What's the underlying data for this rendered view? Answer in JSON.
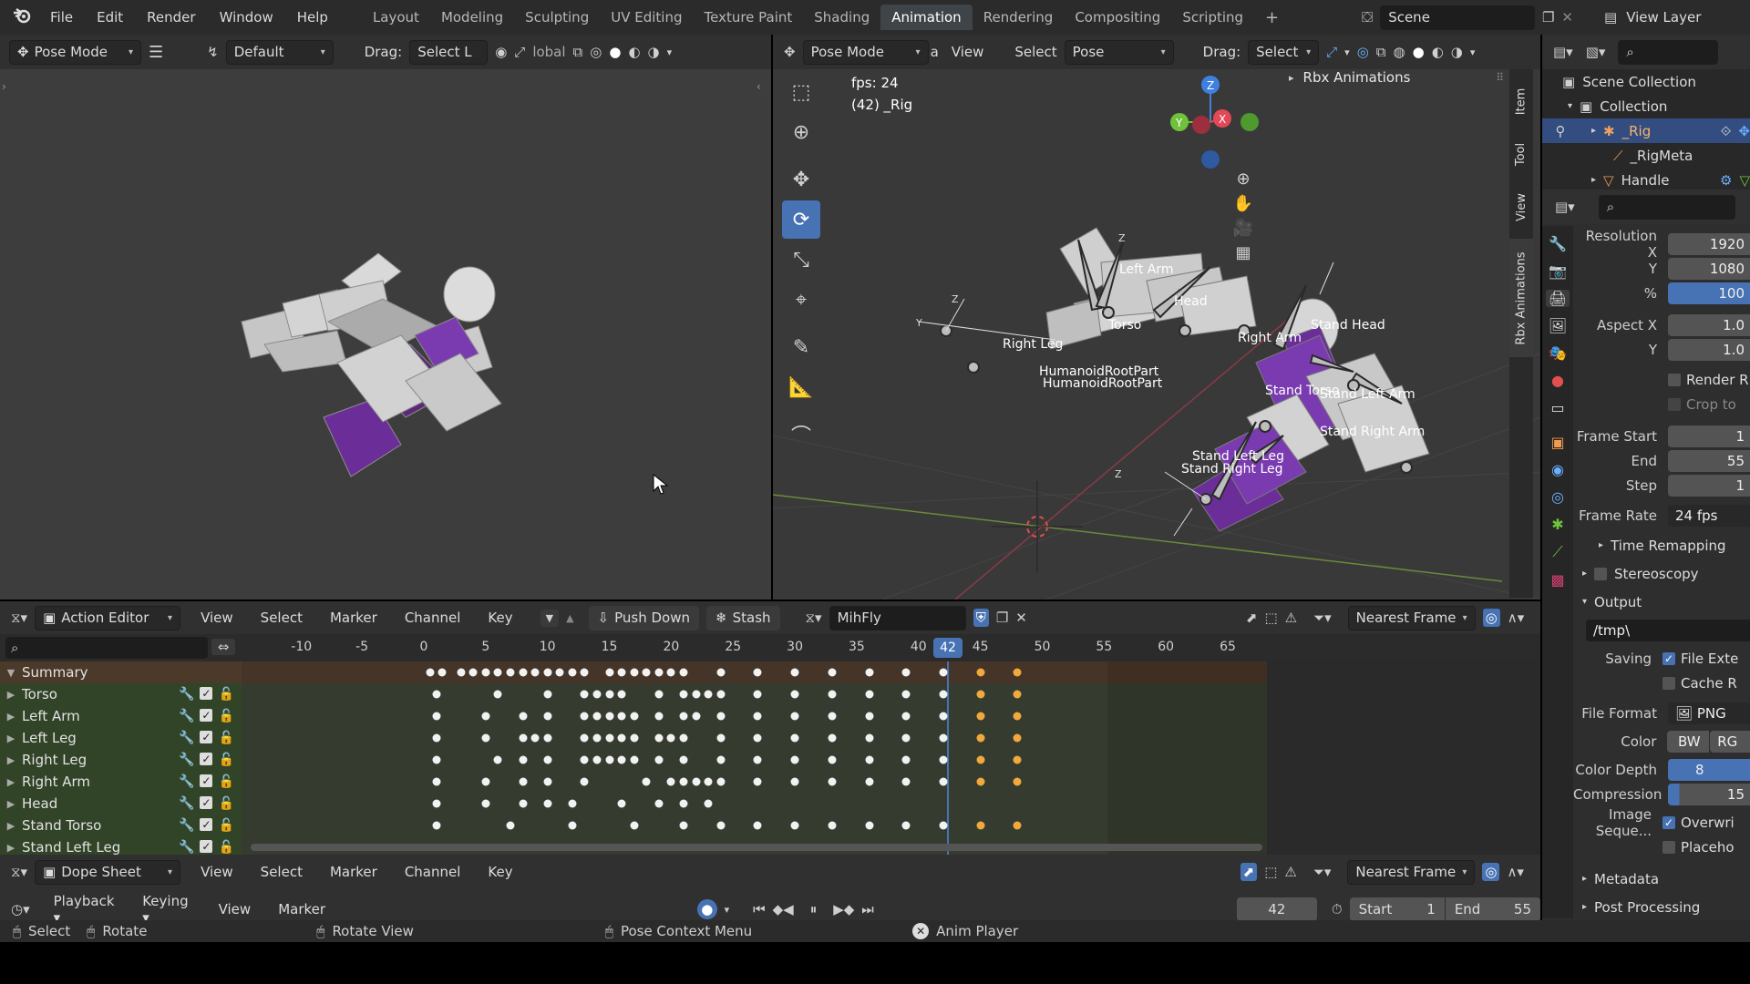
{
  "top_menu": {
    "app_icon": "blender-logo-icon",
    "items": [
      "File",
      "Edit",
      "Render",
      "Window",
      "Help"
    ],
    "workspaces": [
      "Layout",
      "Modeling",
      "Sculpting",
      "UV Editing",
      "Texture Paint",
      "Shading",
      "Animation",
      "Rendering",
      "Compositing",
      "Scripting"
    ],
    "active_workspace": "Animation",
    "add_tab": "+",
    "scene": "Scene",
    "view_layer": "View Layer"
  },
  "left_viewport": {
    "mode": "Pose Mode",
    "orientation_label": "Default",
    "drag_label": "Drag:",
    "drag_value": "Select L",
    "pivot_label": "lobal"
  },
  "main_viewport": {
    "mode": "Pose Mode",
    "menus": [
      "View",
      "Select",
      "Pose"
    ],
    "select_short": "a",
    "drag_label": "Drag:",
    "drag_value": "Select",
    "fps": "fps: 24",
    "object": "(42) _Rig",
    "panel_title": "Rbx Animations",
    "side_tabs": [
      "Item",
      "Tool",
      "View",
      "Rbx Animations"
    ],
    "bone_labels": [
      "Left Arm",
      "Head",
      "Torso",
      "Right Leg",
      "Right Arm",
      "HumanoidRootPart",
      "HumanoidRootPart",
      "Stand Head",
      "Stand Torso",
      "Stand Left Arm",
      "Stand Right Arm",
      "Stand Left Leg",
      "Stand Right Leg"
    ],
    "gizmo": {
      "x": "X",
      "y": "Y",
      "z": "Z"
    }
  },
  "outliner": {
    "search_placeholder": "",
    "scene_collection": "Scene Collection",
    "collection": "Collection",
    "items": [
      "_Rig",
      "_RigMeta",
      "Handle"
    ]
  },
  "properties": {
    "resolution_x_label": "Resolution X",
    "resolution_x": "1920",
    "resolution_y_label": "Y",
    "resolution_y": "1080",
    "percent_label": "%",
    "percent": "100",
    "aspect_x_label": "Aspect X",
    "aspect_x": "1.0",
    "aspect_y_label": "Y",
    "aspect_y": "1.0",
    "render_region": "Render R",
    "crop": "Crop to",
    "frame_start_label": "Frame Start",
    "frame_start": "1",
    "end_label": "End",
    "end": "55",
    "step_label": "Step",
    "step": "1",
    "frame_rate_label": "Frame Rate",
    "frame_rate": "24 fps",
    "time_remapping": "Time Remapping",
    "stereoscopy": "Stereoscopy",
    "output": "Output",
    "output_path": "/tmp\\",
    "saving_label": "Saving",
    "file_ext": "File Exte",
    "cache_result": "Cache R",
    "file_format_label": "File Format",
    "file_format": "PNG",
    "color_label": "Color",
    "color_bw": "BW",
    "color_rgb": "RG",
    "color_depth_label": "Color Depth",
    "color_depth": "8",
    "compression_label": "Compression",
    "compression": "15",
    "image_seq_label": "Image Seque...",
    "overwrite": "Overwri",
    "placeholders": "Placeho",
    "metadata": "Metadata",
    "post_processing": "Post Processing"
  },
  "action_editor": {
    "editor": "Action Editor",
    "menus": [
      "View",
      "Select",
      "Marker",
      "Channel",
      "Key"
    ],
    "push_down": "Push Down",
    "stash": "Stash",
    "action_name": "MihFly",
    "snap": "Nearest Frame",
    "current_frame": "42",
    "ruler": [
      "-10",
      "-5",
      "0",
      "5",
      "10",
      "15",
      "20",
      "25",
      "30",
      "35",
      "40",
      "45",
      "50",
      "55",
      "60",
      "65"
    ],
    "channels": [
      "Summary",
      "Torso",
      "Left Arm",
      "Left Leg",
      "Right Leg",
      "Right Arm",
      "Head",
      "Stand Torso",
      "Stand Left Leg"
    ],
    "keyframes": [
      [
        0.5,
        1.5,
        3,
        4,
        5,
        6,
        7,
        8,
        9,
        10,
        11,
        12,
        13,
        15,
        16,
        17,
        18,
        19,
        20,
        21,
        24,
        27,
        30,
        33,
        36,
        39,
        42,
        45,
        48
      ],
      [
        1,
        6,
        10,
        13,
        14,
        15,
        16,
        19,
        21,
        22,
        23,
        24,
        27,
        30,
        33,
        36,
        39,
        42,
        45,
        48
      ],
      [
        1,
        5,
        8,
        10,
        13,
        14,
        15,
        16,
        17,
        19,
        21,
        22,
        24,
        27,
        30,
        33,
        36,
        39,
        42,
        45,
        48
      ],
      [
        1,
        5,
        8,
        9,
        10,
        13,
        14,
        15,
        16,
        17,
        19,
        20,
        21,
        24,
        27,
        30,
        33,
        36,
        39,
        42,
        45,
        48
      ],
      [
        1,
        6,
        8,
        10,
        13,
        14,
        15,
        16,
        17,
        19,
        21,
        24,
        27,
        30,
        33,
        36,
        39,
        42,
        45,
        48
      ],
      [
        1,
        5,
        8,
        10,
        13,
        18,
        20,
        21,
        22,
        23,
        24,
        27,
        30,
        33,
        36,
        39,
        42,
        45,
        48
      ],
      [
        1,
        5,
        8,
        10,
        12,
        16,
        19,
        21,
        23
      ],
      [
        1,
        7,
        12,
        17,
        21,
        24,
        27,
        30,
        33,
        36,
        39,
        42,
        45,
        48
      ],
      []
    ]
  },
  "dope_sheet": {
    "editor": "Dope Sheet",
    "menus": [
      "View",
      "Select",
      "Marker",
      "Channel",
      "Key"
    ],
    "snap": "Nearest Frame"
  },
  "timeline": {
    "menus": [
      "Playback",
      "Keying",
      "View",
      "Marker"
    ],
    "current_frame": "42",
    "start_label": "Start",
    "start": "1",
    "end_label": "End",
    "end": "55"
  },
  "status_bar": {
    "items": [
      "Select",
      "Rotate",
      "Rotate View",
      "Pose Context Menu",
      "Anim Player"
    ]
  }
}
